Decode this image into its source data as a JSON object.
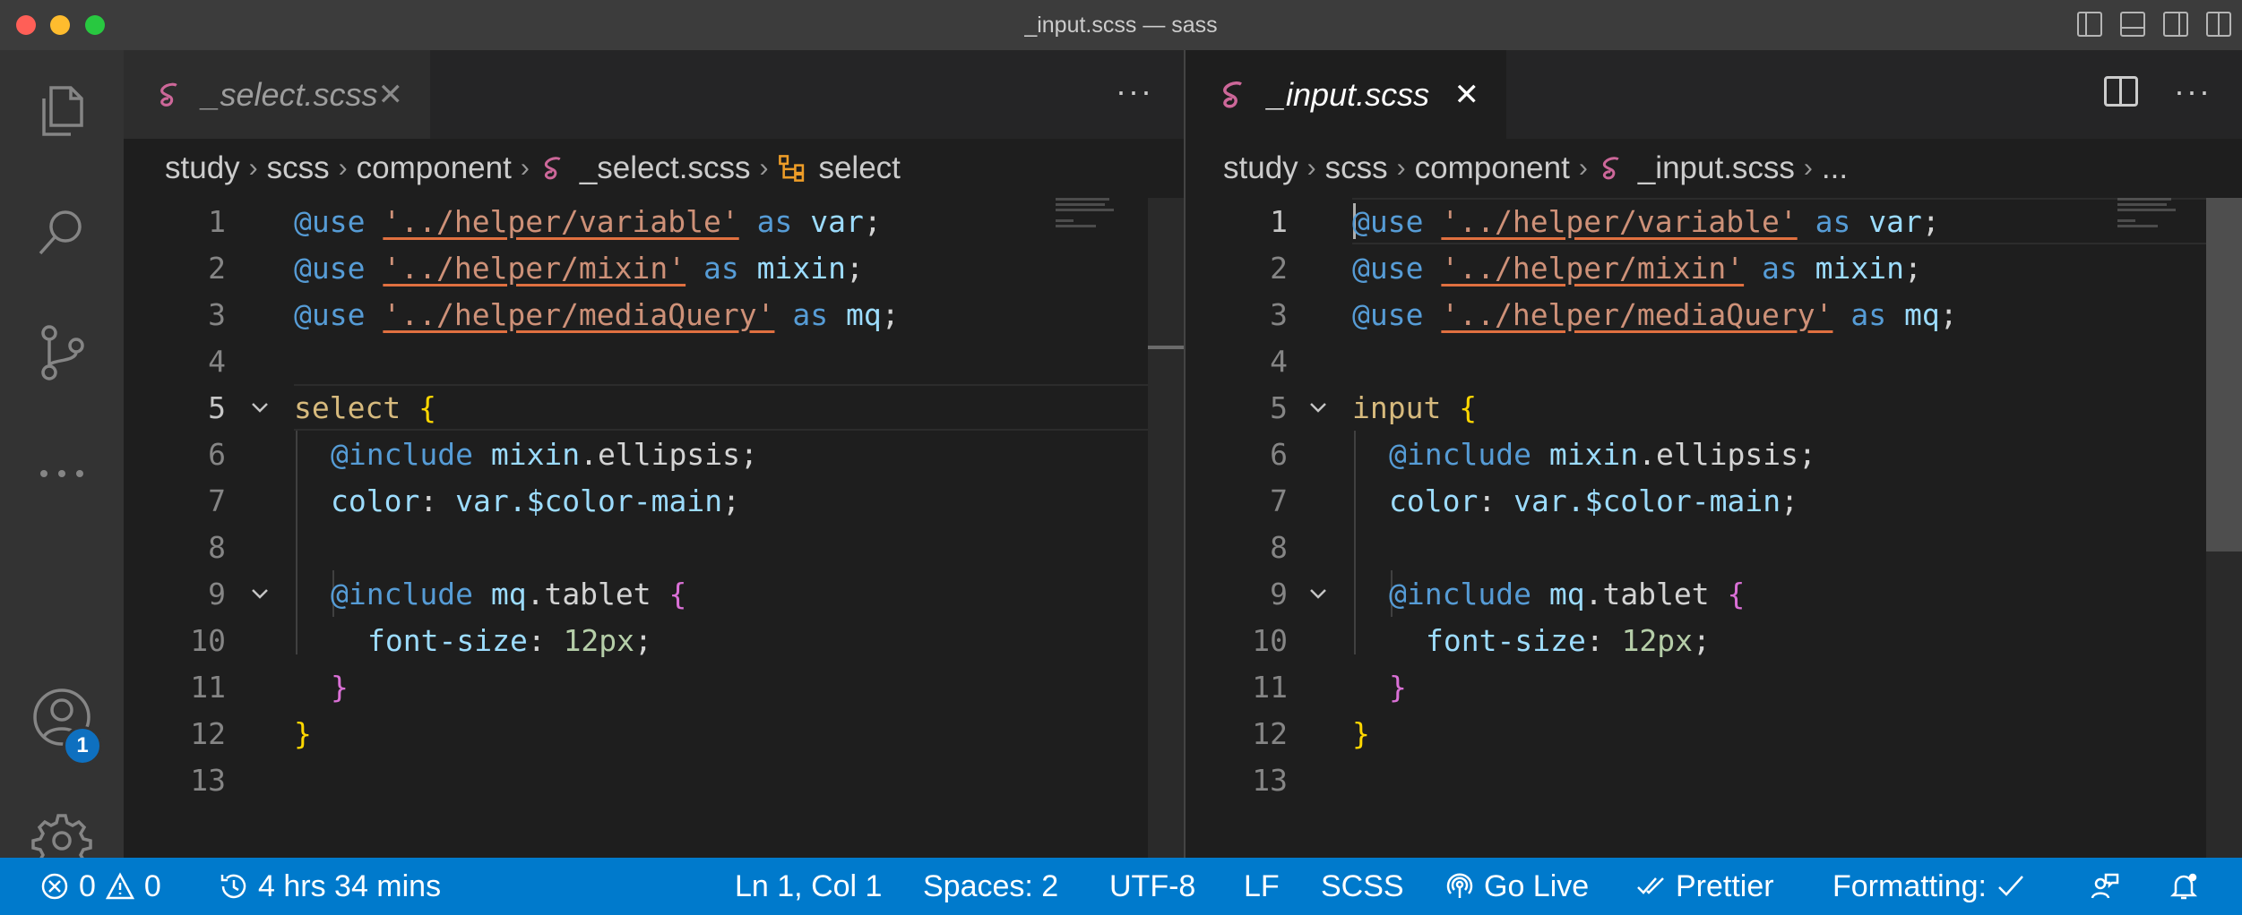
{
  "window": {
    "title": "_input.scss — sass"
  },
  "activity_bar": {
    "items": [
      "explorer-icon",
      "search-icon",
      "source-control-icon",
      "more-icon",
      "accounts-icon",
      "settings-gear-icon"
    ],
    "accounts_badge": "1"
  },
  "editor_left": {
    "tab": {
      "label": "_select.scss",
      "close": "✕"
    },
    "more": "···",
    "breadcrumb": [
      "study",
      "scss",
      "component",
      "_select.scss",
      "select"
    ],
    "line_numbers": [
      "1",
      "2",
      "3",
      "4",
      "5",
      "6",
      "7",
      "8",
      "9",
      "10",
      "11",
      "12",
      "13"
    ],
    "tokens": {
      "use": "@use",
      "path_variable": "'../helper/variable'",
      "path_mixin": "'../helper/mixin'",
      "path_mediaquery": "'../helper/mediaQuery'",
      "as": "as",
      "var": "var",
      "mixin": "mixin",
      "mq": "mq",
      "semicolon": ";",
      "selector": "select",
      "open_brace": "{",
      "close_brace": "}",
      "include": "@include",
      "mixin_ellipsis": "mixin",
      "dot_ellipsis": ".ellipsis",
      "color_prop": "color",
      "colon": ":",
      "var_color": "var",
      "color_value": ".$color-main",
      "mq_tablet_obj": "mq",
      "tablet": ".tablet",
      "font_size_prop": "font-size",
      "font_size_value": "12px"
    }
  },
  "editor_right": {
    "tab": {
      "label": "_input.scss",
      "close": "✕"
    },
    "more": "···",
    "breadcrumb": [
      "study",
      "scss",
      "component",
      "_input.scss",
      "..."
    ],
    "line_numbers": [
      "1",
      "2",
      "3",
      "4",
      "5",
      "6",
      "7",
      "8",
      "9",
      "10",
      "11",
      "12",
      "13"
    ],
    "tokens": {
      "use": "@use",
      "path_variable": "'../helper/variable'",
      "path_mixin": "'../helper/mixin'",
      "path_mediaquery": "'../helper/mediaQuery'",
      "as": "as",
      "var": "var",
      "mixin": "mixin",
      "mq": "mq",
      "semicolon": ";",
      "selector": "input",
      "open_brace": "{",
      "close_brace": "}",
      "include": "@include",
      "mixin_ellipsis": "mixin",
      "dot_ellipsis": ".ellipsis",
      "color_prop": "color",
      "colon": ":",
      "var_color": "var",
      "color_value": ".$color-main",
      "mq_tablet_obj": "mq",
      "tablet": ".tablet",
      "font_size_prop": "font-size",
      "font_size_value": "12px"
    }
  },
  "status_bar": {
    "errors": "0",
    "warnings": "0",
    "time": "4 hrs 34 mins",
    "cursor": "Ln 1, Col 1",
    "spaces": "Spaces: 2",
    "encoding": "UTF-8",
    "eol": "LF",
    "language": "SCSS",
    "go_live": "Go Live",
    "prettier": "Prettier",
    "formatting": "Formatting:"
  },
  "colors": {
    "status_bar": "#007acc",
    "activity_bar": "#333333",
    "editor_bg": "#1e1e1e",
    "badge": "#0e70c0",
    "sass_pink": "#cd6799"
  }
}
